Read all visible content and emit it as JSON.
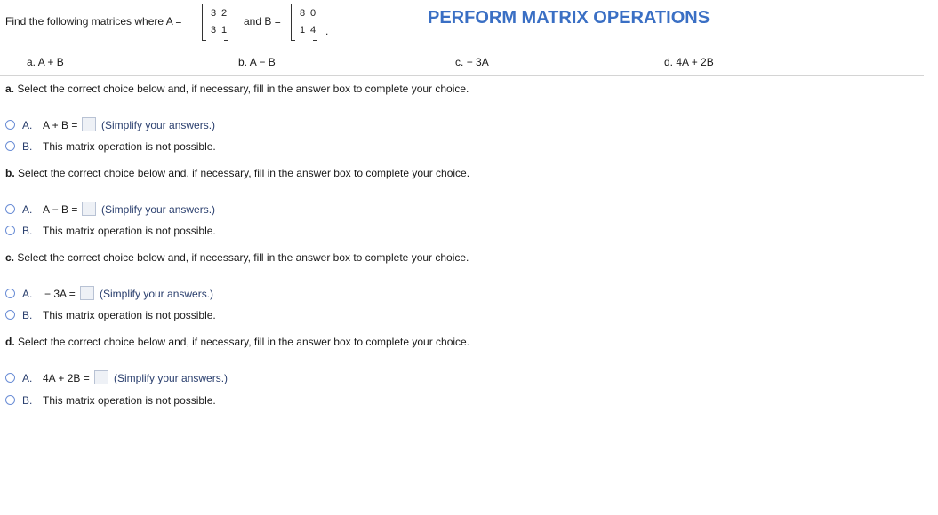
{
  "prompt": {
    "intro": "Find the following matrices where A =",
    "and_b": "and B =",
    "dot": ".",
    "matrix_a": [
      [
        "3",
        "2"
      ],
      [
        "3",
        "1"
      ]
    ],
    "matrix_b": [
      [
        "8",
        "0"
      ],
      [
        "1",
        "4"
      ]
    ]
  },
  "title": "PERFORM MATRIX OPERATIONS",
  "parts": [
    {
      "letter": "a.",
      "expr": "A + B"
    },
    {
      "letter": "b.",
      "expr": "A − B"
    },
    {
      "letter": "c.",
      "expr": "− 3A"
    },
    {
      "letter": "d.",
      "expr": "4A + 2B"
    }
  ],
  "questions": [
    {
      "letter": "a.",
      "instruction": "Select the correct choice below and, if necessary, fill in the answer box to complete your choice.",
      "option_a_letter": "A.",
      "option_a_expr": "A + B =",
      "option_a_hint": "(Simplify your answers.)",
      "option_b_letter": "B.",
      "option_b_text": "This matrix operation is not possible."
    },
    {
      "letter": "b.",
      "instruction": "Select the correct choice below and, if necessary, fill in the answer box to complete your choice.",
      "option_a_letter": "A.",
      "option_a_expr": "A − B =",
      "option_a_hint": "(Simplify your answers.)",
      "option_b_letter": "B.",
      "option_b_text": "This matrix operation is not possible."
    },
    {
      "letter": "c.",
      "instruction": "Select the correct choice below and, if necessary, fill in the answer box to complete your choice.",
      "option_a_letter": "A.",
      "option_a_expr": "− 3A =",
      "option_a_hint": "(Simplify your answers.)",
      "option_b_letter": "B.",
      "option_b_text": "This matrix operation is not possible."
    },
    {
      "letter": "d.",
      "instruction": "Select the correct choice below and, if necessary, fill in the answer box to complete your choice.",
      "option_a_letter": "A.",
      "option_a_expr": "4A + 2B =",
      "option_a_hint": "(Simplify your answers.)",
      "option_b_letter": "B.",
      "option_b_text": "This matrix operation is not possible."
    }
  ],
  "colors": {
    "title": "#3a6fc4",
    "option_letter": "#2a3f6e",
    "radio_border": "#6b8ed6"
  }
}
